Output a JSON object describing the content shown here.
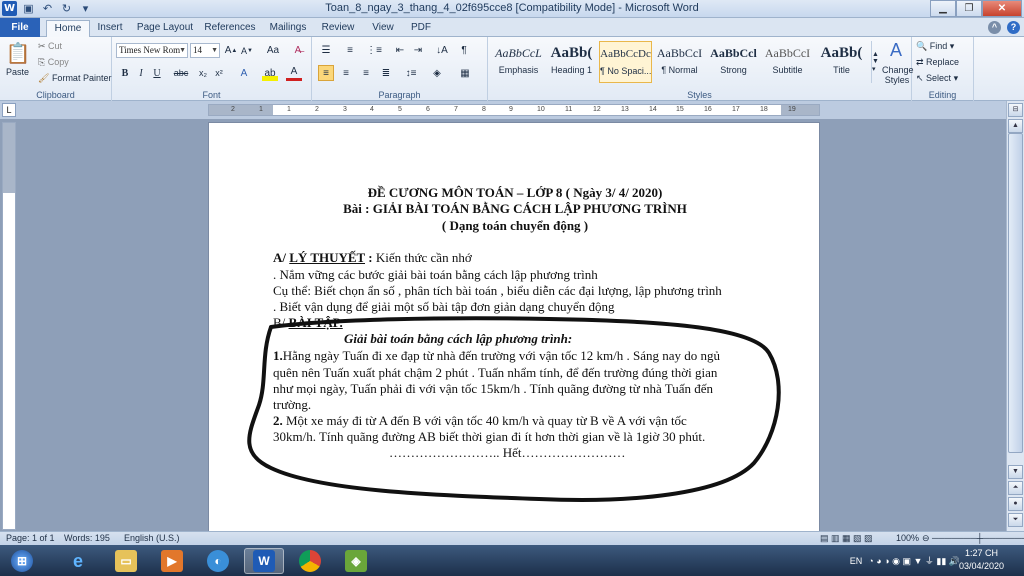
{
  "window": {
    "title": "Toan_8_ngay_3_thang_4_02f695cce8 [Compatibility Mode] - Microsoft Word"
  },
  "tabs": [
    "File",
    "Home",
    "Insert",
    "Page Layout",
    "References",
    "Mailings",
    "Review",
    "View",
    "PDF"
  ],
  "ribbon": {
    "clipboard": {
      "paste": "Paste",
      "cut": "Cut",
      "copy": "Copy",
      "format_painter": "Format Painter",
      "label": "Clipboard"
    },
    "font": {
      "name": "Times New Rom",
      "size": "14",
      "label": "Font"
    },
    "paragraph": {
      "label": "Paragraph"
    },
    "styles": {
      "label": "Styles",
      "items": [
        {
          "sample": "AaBbCcL",
          "name": "Emphasis"
        },
        {
          "sample": "AaBb(",
          "name": "Heading 1"
        },
        {
          "sample": "AaBbCcDc",
          "name": "¶ No Spaci..."
        },
        {
          "sample": "AaBbCcI",
          "name": "¶ Normal"
        },
        {
          "sample": "AaBbCcl",
          "name": "Strong"
        },
        {
          "sample": "AaBbCcI",
          "name": "Subtitle"
        },
        {
          "sample": "AaBb(",
          "name": "Title"
        }
      ],
      "change_styles": "Change Styles"
    },
    "editing": {
      "find": "Find",
      "replace": "Replace",
      "select": "Select",
      "label": "Editing"
    }
  },
  "ruler": {
    "marks": [
      "2",
      "1",
      "1",
      "2",
      "3",
      "4",
      "5",
      "6",
      "7",
      "8",
      "9",
      "10",
      "11",
      "12",
      "13",
      "14",
      "15",
      "16",
      "17",
      "18",
      "19"
    ]
  },
  "document": {
    "title1": "ĐỀ CƯƠNG MÔN TOÁN – LỚP 8    ( Ngày 3/ 4/ 2020)",
    "title2": "Bài : GIẢI BÀI TOÁN BẰNG CÁCH LẬP PHƯƠNG TRÌNH",
    "title3": "( Dạng toán chuyển động )",
    "sectionA_prefix": "A/ ",
    "sectionA_heading": "LÝ THUYẾT",
    "sectionA_colon": " : ",
    "sectionA_rest": " Kiến thức cần nhớ",
    "a1": ". Nắm vững các bước giải bài toán bằng cách lập phương trình",
    "a2_prefix": "  Cụ thể",
    "a2_rest": ": Biết chọn ẩn số , phân tích bài toán , biểu diễn các đại lượng, lập phương trình",
    "a3": ". Biết vận dụng để giải một số bài tập đơn giản dạng chuyển động",
    "sectionB_prefix": "B/ ",
    "sectionB_heading": "BÀI TẬP.",
    "subheading": "Giải bài toán bằng cách lập phương trình:",
    "p1_num": "1.",
    "p1_l1": "Hằng ngày Tuấn đi xe đạp từ nhà đến trường với vận tốc 12 km/h . Sáng nay do ngủ",
    "p1_l2": "quên nên Tuấn xuất phát chậm 2 phút . Tuấn nhẩm tính, để đến trường đúng thời gian",
    "p1_l3": "như mọi ngày, Tuấn phải đi với vận tốc 15km/h . Tính quãng đường từ nhà Tuấn đến",
    "p1_l4": "trường.",
    "p2_num": " 2.",
    "p2_l1": " Một xe máy đi từ A đến B với vận tốc 40 km/h và quay từ B về A với vận tốc",
    "p2_l2": "30km/h. Tính quãng đường AB biết thời gian đi ít hơn thời gian về là 1giờ 30 phút.",
    "end": "…………………….. Hết……………………"
  },
  "status": {
    "page": "Page: 1 of 1",
    "words": "Words: 195",
    "language": "English (U.S.)",
    "zoom": "100%"
  },
  "taskbar": {
    "lang": "EN",
    "time": "1:27 CH",
    "date": "03/04/2020"
  }
}
